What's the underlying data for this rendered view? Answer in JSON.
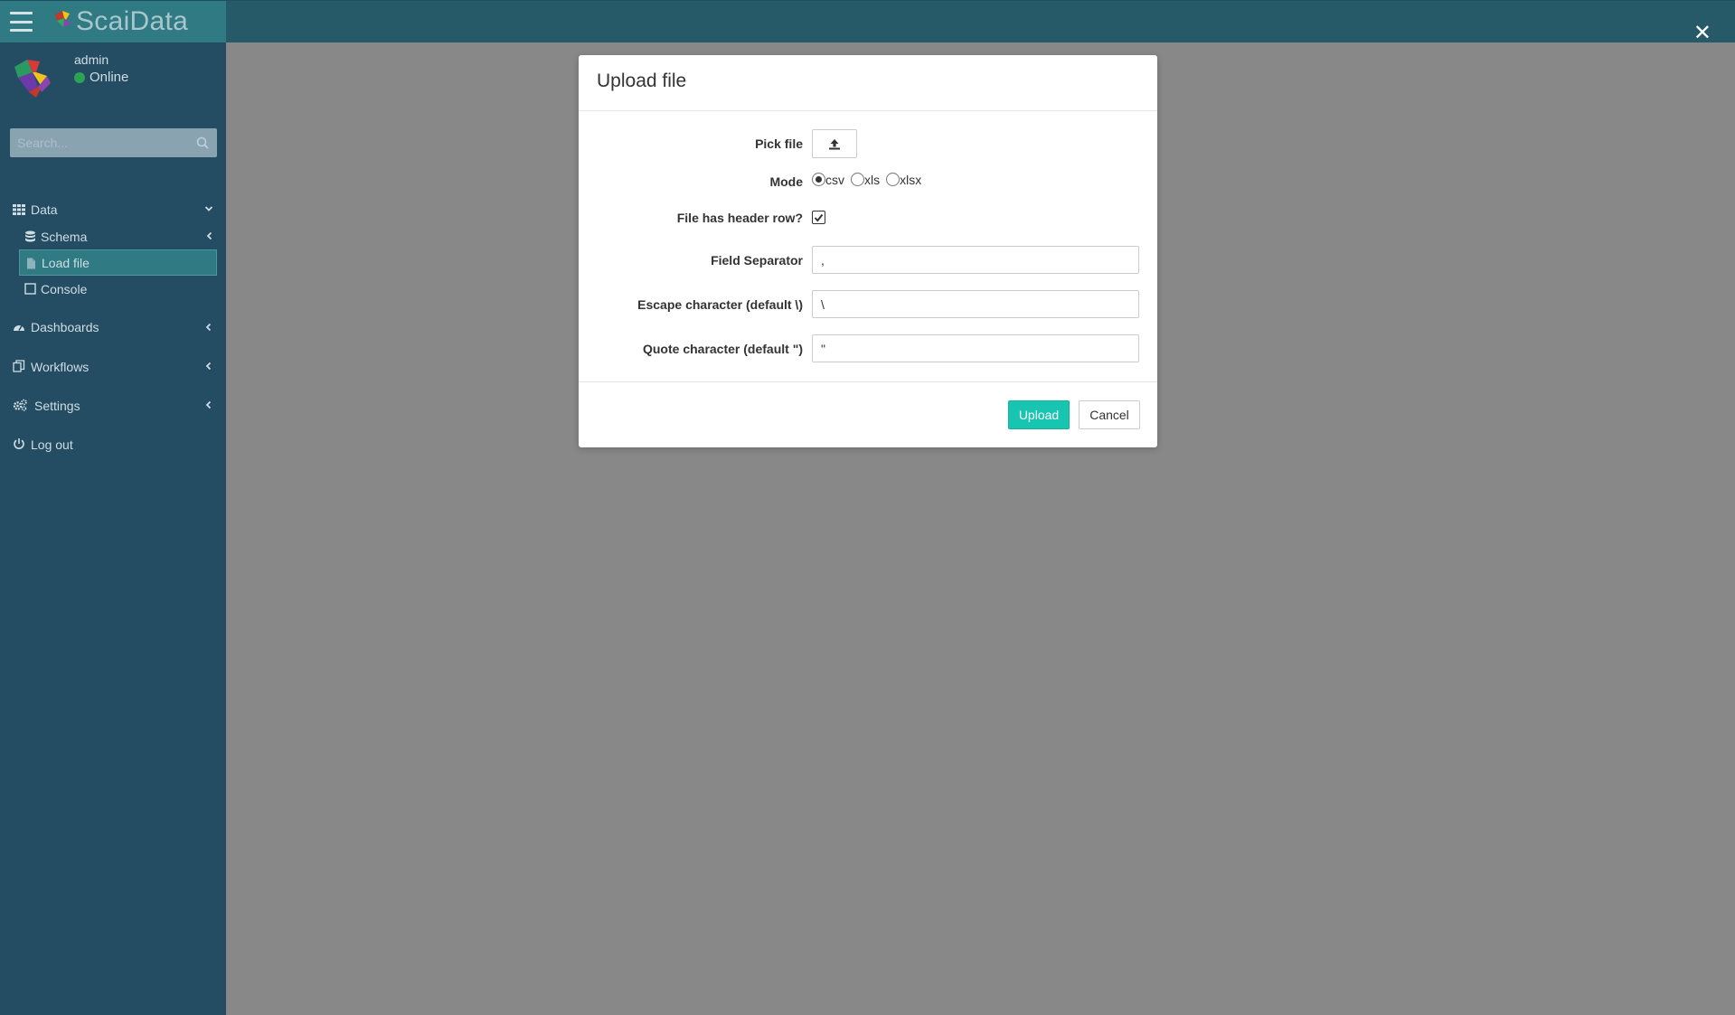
{
  "app": {
    "title": "ScaiData",
    "close_glyph": "✕"
  },
  "user": {
    "name": "admin",
    "status": "Online",
    "status_color": "#2aa454"
  },
  "search": {
    "placeholder": "Search..."
  },
  "nav": {
    "data": {
      "label": "Data",
      "icon": "grid-icon"
    },
    "schema": {
      "label": "Schema",
      "icon": "database-icon"
    },
    "load_file": {
      "label": "Load file",
      "icon": "file-icon",
      "active": true
    },
    "console": {
      "label": "Console",
      "icon": "square-icon"
    },
    "dashboards": {
      "label": "Dashboards",
      "icon": "dashboard-icon"
    },
    "workflows": {
      "label": "Workflows",
      "icon": "copy-icon"
    },
    "settings": {
      "label": "Settings",
      "icon": "gears-icon"
    },
    "logout": {
      "label": "Log out",
      "icon": "power-icon"
    }
  },
  "modal": {
    "title": "Upload file",
    "pick_file_label": "Pick file",
    "mode_label": "Mode",
    "mode_options": [
      "csv",
      "xls",
      "xlsx"
    ],
    "mode_selected": "csv",
    "header_row_label": "File has header row?",
    "header_row_checked": true,
    "field_separator_label": "Field Separator",
    "field_separator_value": ",",
    "escape_label": "Escape character (default \\)",
    "escape_value": "\\",
    "quote_label": "Quote character (default \")",
    "quote_value": "\"",
    "upload_label": "Upload",
    "cancel_label": "Cancel"
  },
  "colors": {
    "topbar": "#275a68",
    "brand": "#2f7a83",
    "sidebar": "#244d63",
    "overlay": "#888888",
    "accent": "#18c5b0"
  }
}
